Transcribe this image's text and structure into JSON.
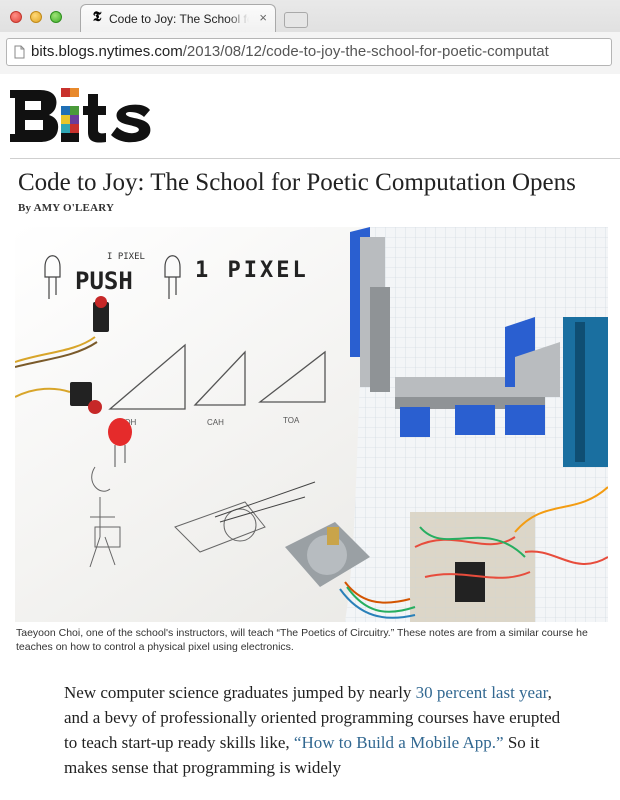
{
  "browser": {
    "tab": {
      "title": "Code to Joy: The School for Poetic Computation Opens",
      "favicon": "nyt-t-icon",
      "close_glyph": "×"
    },
    "address_bar": {
      "url_host": "bits.blogs.nytimes.com",
      "url_path": "/2013/08/12/code-to-joy-the-school-for-poetic-computat"
    }
  },
  "site": {
    "logo_text": "Bits"
  },
  "article": {
    "headline": "Code to Joy: The School for Poetic Computation Opens",
    "byline": "By AMY O'LEARY",
    "photo": {
      "sketch_text_small": "I PIXEL",
      "sketch_text_main_1": "PUSH",
      "sketch_text_main_2": "1 PIXEL",
      "sketch_label_1": "SOH",
      "sketch_label_2": "CAH",
      "sketch_label_3": "TOA"
    },
    "caption": "Taeyoon Choi, one of the school's instructors, will teach “The Poetics of Circuitry.” These notes are from a similar course he teaches on how to control a physical pixel using electronics.",
    "body": {
      "part1": "New computer science graduates jumped by nearly ",
      "link1": "30 percent last year",
      "part2": ", and a bevy of professionally oriented programming courses have erupted to teach start-up ready skills like, ",
      "link2": "“How to Build a Mobile App.”",
      "part3": " So it makes sense that programming is widely"
    }
  },
  "colors": {
    "link": "#326891",
    "logo_dark": "#111111",
    "logo_accent_blue": "#1f6fb5",
    "logo_accent_green": "#4a9a3a",
    "logo_accent_orange": "#e8892b",
    "logo_accent_red": "#c8322d",
    "lego_blue": "#2a5fd0"
  }
}
